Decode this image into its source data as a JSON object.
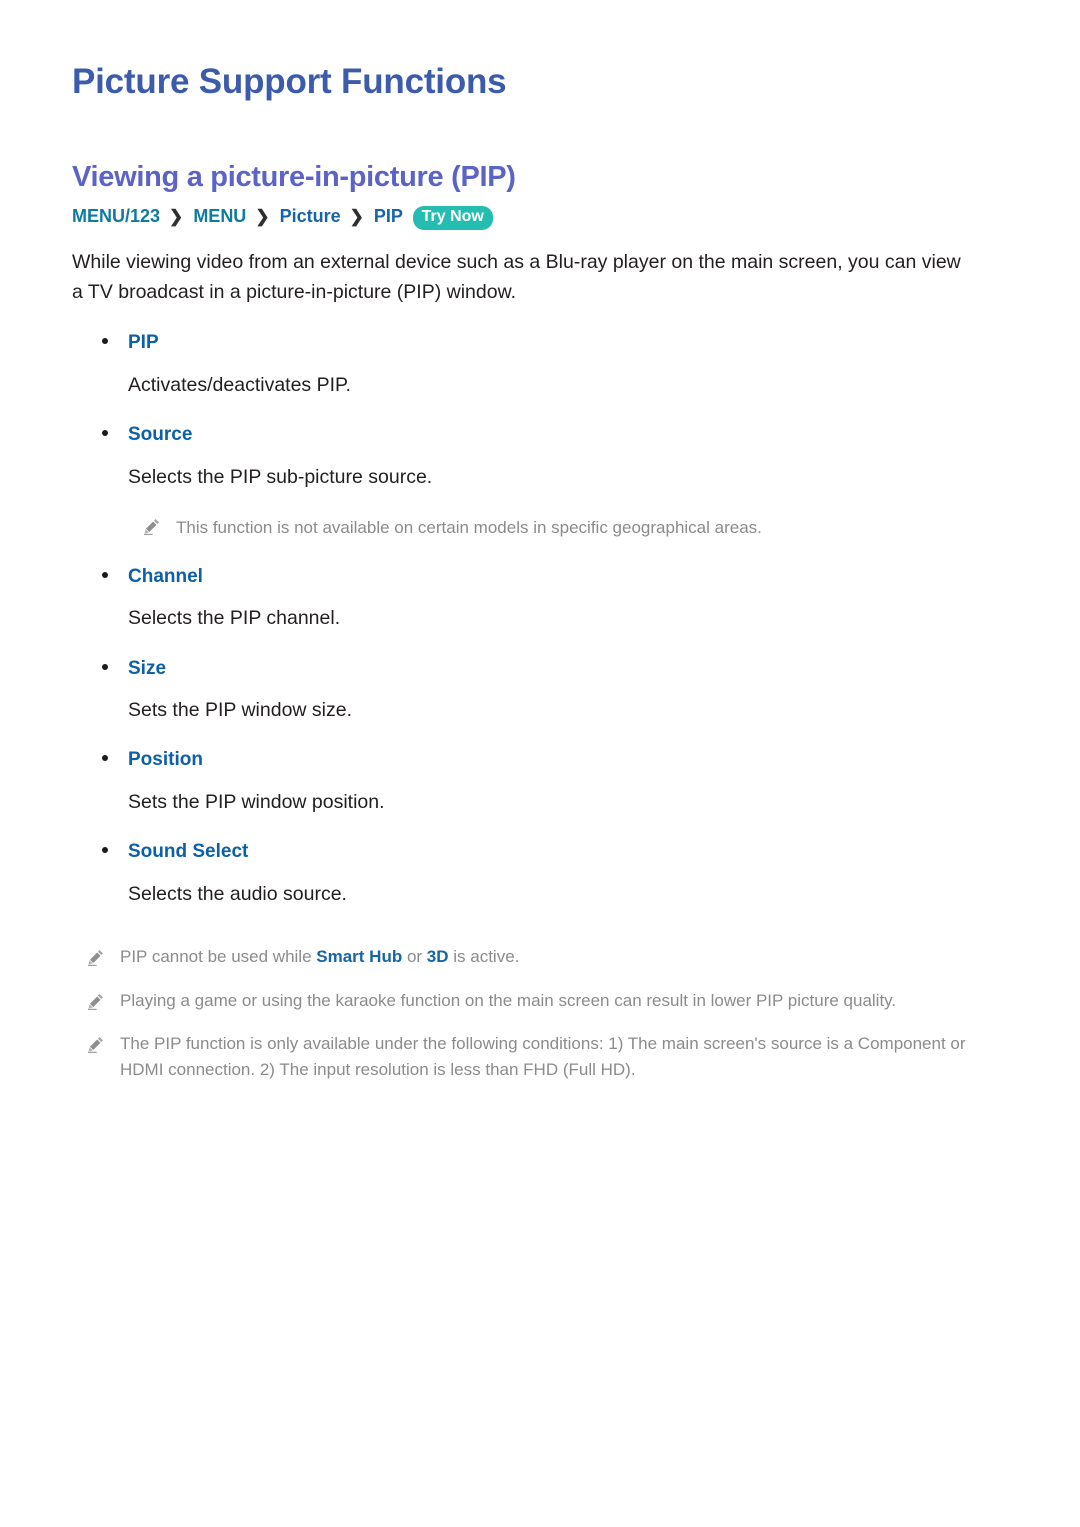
{
  "document": {
    "page_title": "Picture Support Functions",
    "section_title": "Viewing a picture-in-picture (PIP)"
  },
  "breadcrumb": {
    "items": [
      {
        "label": "MENU/123",
        "style": "teal"
      },
      {
        "label": "MENU",
        "style": "teal"
      },
      {
        "label": "Picture",
        "style": "blue"
      },
      {
        "label": "PIP",
        "style": "blue"
      }
    ],
    "separator": "❯",
    "badge": "Try Now"
  },
  "intro": "While viewing video from an external device such as a Blu-ray player on the main screen, you can view a TV broadcast in a picture-in-picture (PIP) window.",
  "options": [
    {
      "label": "PIP",
      "description": "Activates/deactivates PIP."
    },
    {
      "label": "Source",
      "description": "Selects the PIP sub-picture source.",
      "note": "This function is not available on certain models in specific geographical areas."
    },
    {
      "label": "Channel",
      "description": "Selects the PIP channel."
    },
    {
      "label": "Size",
      "description": "Sets the PIP window size."
    },
    {
      "label": "Position",
      "description": "Sets the PIP window position."
    },
    {
      "label": "Sound Select",
      "description": "Selects the audio source."
    }
  ],
  "footnotes": [
    {
      "parts": [
        {
          "text": "PIP cannot be used while ",
          "emphasis": false
        },
        {
          "text": "Smart Hub",
          "emphasis": true
        },
        {
          "text": " or ",
          "emphasis": false
        },
        {
          "text": "3D",
          "emphasis": true
        },
        {
          "text": " is active.",
          "emphasis": false
        }
      ]
    },
    {
      "parts": [
        {
          "text": "Playing a game or using the karaoke function on the main screen can result in lower PIP picture quality.",
          "emphasis": false
        }
      ]
    },
    {
      "parts": [
        {
          "text": "The PIP function is only available under the following conditions: 1) The main screen's source is a Component or HDMI connection. 2) The input resolution is less than FHD (Full HD).",
          "emphasis": false
        }
      ]
    }
  ],
  "colors": {
    "page_title": "#3c5cab",
    "section_title": "#5c63c6",
    "breadcrumb_teal": "#0f7b9e",
    "breadcrumb_blue": "#1565a8",
    "badge_background": "#25bdb1",
    "option_label": "#0d5fa8",
    "body_text": "#231f20",
    "note_text": "#8b8b8b"
  },
  "icons": {
    "note": "pencil-icon"
  }
}
